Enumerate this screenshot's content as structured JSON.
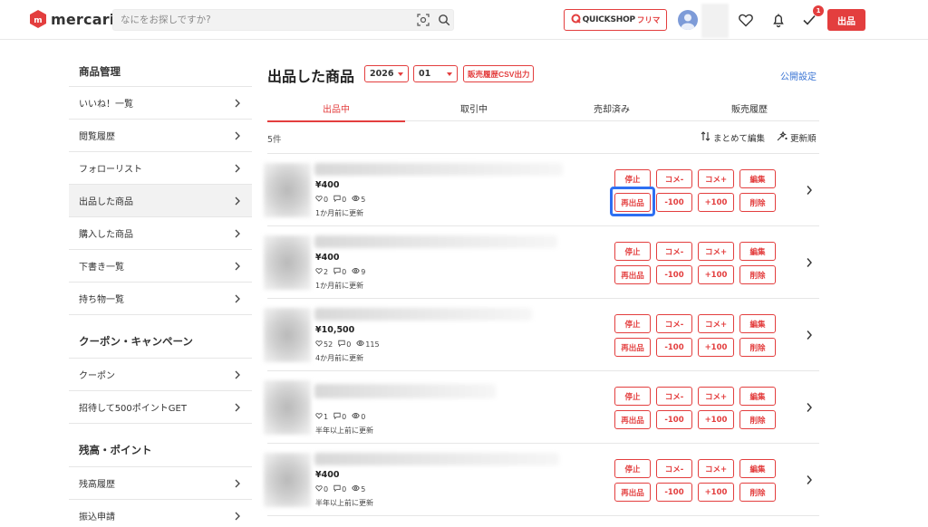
{
  "header": {
    "logo_text": "mercari",
    "search_placeholder": "なにをお探しですか?",
    "quickshop_label": "QUICKSHOP",
    "quickshop_sub": "フリマ",
    "notification_badge": "1",
    "sell_button": "出品",
    "brand_color": "#e33e3e"
  },
  "sidebar": {
    "sections": [
      {
        "heading": "商品管理",
        "items": [
          {
            "label": "いいね！一覧",
            "active": false
          },
          {
            "label": "閲覧履歴",
            "active": false
          },
          {
            "label": "フォローリスト",
            "active": false
          },
          {
            "label": "出品した商品",
            "active": true
          },
          {
            "label": "購入した商品",
            "active": false
          },
          {
            "label": "下書き一覧",
            "active": false
          },
          {
            "label": "持ち物一覧",
            "active": false
          }
        ]
      },
      {
        "heading": "クーポン・キャンペーン",
        "items": [
          {
            "label": "クーポン",
            "active": false
          },
          {
            "label": "招待して500ポイントGET",
            "active": false
          }
        ]
      },
      {
        "heading": "残高・ポイント",
        "items": [
          {
            "label": "残高履歴",
            "active": false
          },
          {
            "label": "振込申請",
            "active": false
          }
        ]
      }
    ]
  },
  "main": {
    "title": "出品した商品",
    "year_select": "2026",
    "month_select": "01",
    "csv_button": "販売履歴CSV出力",
    "public_settings": "公開設定",
    "tabs": [
      {
        "label": "出品中",
        "active": true
      },
      {
        "label": "取引中",
        "active": false
      },
      {
        "label": "売却済み",
        "active": false
      },
      {
        "label": "販売履歴",
        "active": false
      }
    ],
    "count": "5件",
    "bulk_edit": "まとめて編集",
    "sort": "更新順",
    "actions": {
      "stop": "停止",
      "comment_minus": "コメ-",
      "comment_plus": "コメ+",
      "edit": "編集",
      "relist": "再出品",
      "minus100": "-100",
      "plus100": "+100",
      "delete": "削除"
    },
    "listings": [
      {
        "price": "¥400",
        "likes": "0",
        "comments": "0",
        "views": "5",
        "updated": "1か月前に更新"
      },
      {
        "price": "¥400",
        "likes": "2",
        "comments": "0",
        "views": "9",
        "updated": "1か月前に更新"
      },
      {
        "price": "¥10,500",
        "likes": "52",
        "comments": "0",
        "views": "115",
        "updated": "4か月前に更新"
      },
      {
        "price": "",
        "likes": "1",
        "comments": "0",
        "views": "0",
        "updated": "半年以上前に更新"
      },
      {
        "price": "¥400",
        "likes": "0",
        "comments": "0",
        "views": "5",
        "updated": "半年以上前に更新"
      }
    ]
  }
}
